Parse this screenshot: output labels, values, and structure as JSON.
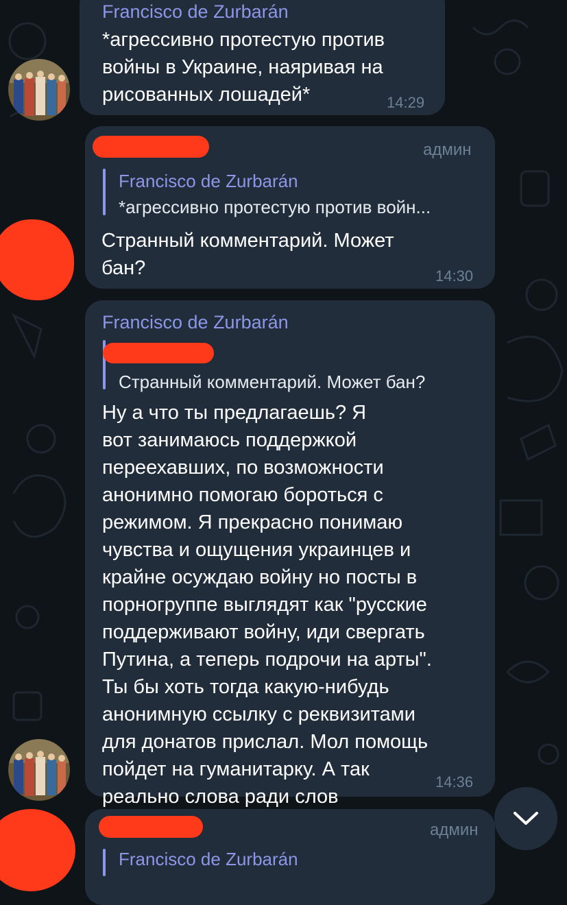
{
  "messages": [
    {
      "sender": "Francisco de Zurbarán",
      "text": "*агрессивно протестую против\nвойны в Украине, наяривая на\nрисованных лошадей*",
      "time": "14:29"
    },
    {
      "role": "админ",
      "reply": {
        "name": "Francisco de Zurbarán",
        "text": "*агрессивно протестую против войн..."
      },
      "text": "Странный комментарий. Может\nбан?",
      "time": "14:30"
    },
    {
      "sender": "Francisco de Zurbarán",
      "reply": {
        "text": "Странный комментарий. Может бан?"
      },
      "text": "Ну а что ты предлагаешь? Я\nвот занимаюсь поддержкой\nпереехавших, по возможности\nанонимно помогаю бороться с\nрежимом. Я прекрасно понимаю\nчувства и ощущения украинцев и\nкрайне осуждаю войну но посты в\nпорногруппе выглядят как \"русские\nподдерживают войну, иди свергать\nПутина, а теперь подрочи на арты\".\nТы бы хоть тогда какую-нибудь\nанонимную ссылку с реквизитами\nдля донатов прислал. Мол помощь\nпойдет на гуманитарку. А так\nреально слова ради слов",
      "time": "14:36"
    },
    {
      "role": "админ",
      "reply": {
        "name": "Francisco de Zurbarán"
      }
    }
  ],
  "icons": {
    "scroll_down": "chevron-down-icon",
    "avatar": "painting-avatar"
  },
  "colors": {
    "background": "#0f1419",
    "bubble": "#212d3b",
    "sender": "#8e96e8",
    "meta": "#6d8196",
    "redaction": "#ff3a1a"
  }
}
